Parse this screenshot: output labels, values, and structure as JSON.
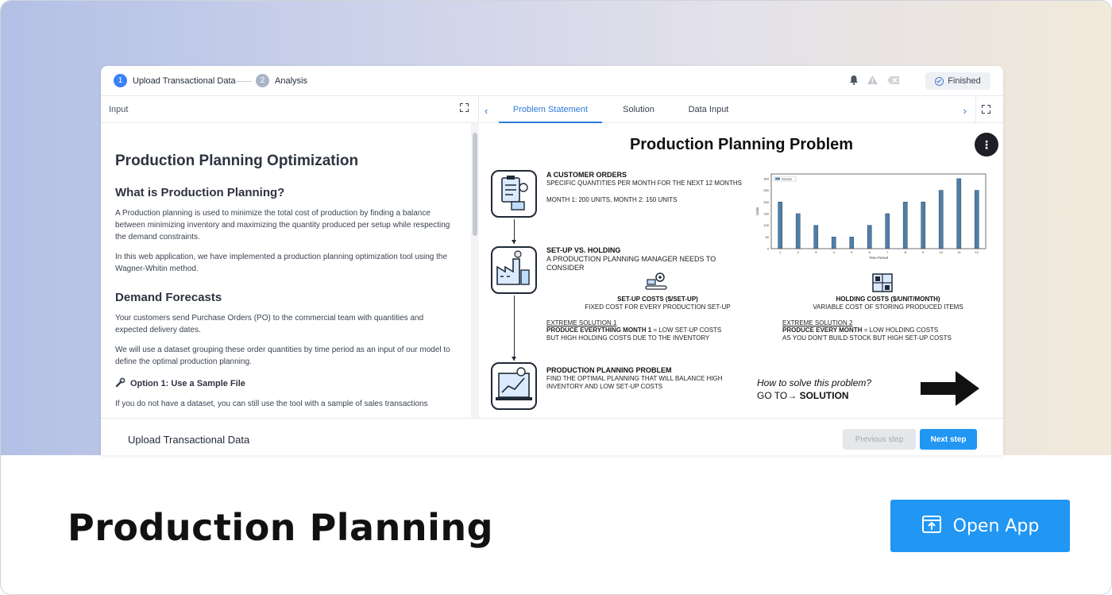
{
  "stepper": {
    "steps": [
      {
        "num": "1",
        "label": "Upload Transactional Data"
      },
      {
        "num": "2",
        "label": "Analysis"
      }
    ],
    "status": "Finished"
  },
  "left_panel": {
    "header": "Input",
    "title": "Production Planning Optimization",
    "section1_title": "What is Production Planning?",
    "section1_p1": "A Production planning is used to minimize the total cost of production by finding a balance between minimizing inventory and maximizing the quantity produced per setup while respecting the demand constraints.",
    "section1_p2": "In this web application, we have implemented a production planning optimization tool using the Wagner-Whitin method.",
    "section2_title": "Demand Forecasts",
    "section2_p1": "Your customers send Purchase Orders (PO) to the commercial team with quantities and expected delivery dates.",
    "section2_p2": "We will use a dataset grouping these order quantities by time period as an input of our model to define the optimal production planning.",
    "option1_title": "Option 1: Use a Sample File",
    "option1_p": "If you do not have a dataset, you can still use the tool with a sample of sales transactions"
  },
  "tabs": [
    "Problem Statement",
    "Solution",
    "Data Input"
  ],
  "slide": {
    "title": "Production Planning Problem",
    "customer_head": "A CUSTOMER ORDERS",
    "customer_text": "SPECIFIC QUANTITIES  PER MONTH FOR THE NEXT 12 MONTHS",
    "customer_months": "MONTH 1: 200 UNITS,  MONTH 2: 150 UNITS",
    "setup_head": "SET-UP VS. HOLDING",
    "setup_text": "A PRODUCTION PLANNING MANAGER NEEDS TO CONSIDER",
    "setup_cost_head": "SET-UP COSTS ($/SET-UP)",
    "setup_cost_text": "FIXED COST FOR EVERY PRODUCTION  SET-UP",
    "holding_cost_head": "HOLDING COSTS ($/UNIT/MONTH)",
    "holding_cost_text": "VARIABLE COST OF STORING  PRODUCED ITEMS",
    "extreme1_title": "EXTREME SOLUTION  1",
    "extreme1_line1_bold": "PRODUCE EVERYTHING MONTH 1",
    "extreme1_line1_rest": " = LOW SET-UP COSTS",
    "extreme1_line2": "BUT HIGH HOLDING COSTS DUE TO THE INVENTORY",
    "extreme2_title": "EXTREME SOLUTION  2",
    "extreme2_line1_bold": "PRODUCE EVERY MONTH",
    "extreme2_line1_rest": " = LOW HOLDING COSTS",
    "extreme2_line2": "AS YOU DON'T BUILD STOCK BUT HIGH SET-UP COSTS",
    "problem_head": "PRODUCTION PLANNING PROBLEM",
    "problem_text": "FIND THE OPTIMAL PLANNING THAT WILL BALANCE HIGH INVENTORY  AND LOW SET-UP COSTS",
    "howto": "How to solve this problem?",
    "goto_prefix": "GO TO→ ",
    "goto_bold": "SOLUTION"
  },
  "chart_data": {
    "type": "bar",
    "categories": [
      "1",
      "2",
      "3",
      "4",
      "5",
      "6",
      "7",
      "8",
      "9",
      "10",
      "11",
      "12"
    ],
    "series": [
      {
        "name": "forecast",
        "values": [
          200,
          150,
          100,
          50,
          50,
          100,
          150,
          200,
          200,
          250,
          300,
          250
        ]
      }
    ],
    "xlabel": "Time Period",
    "ylabel": "Units",
    "ylim": [
      0,
      320
    ],
    "yticks": [
      0,
      50,
      100,
      150,
      200,
      250,
      300
    ],
    "legend": "top-left",
    "color": "#4f7ea8"
  },
  "footer": {
    "left_title": "Upload Transactional Data",
    "prev_label": "Previous step",
    "next_label": "Next step"
  },
  "card": {
    "app_title": "Production Planning",
    "open_label": "Open App"
  },
  "colors": {
    "accent": "#2196f3",
    "tab_active": "#2f7ad8"
  }
}
